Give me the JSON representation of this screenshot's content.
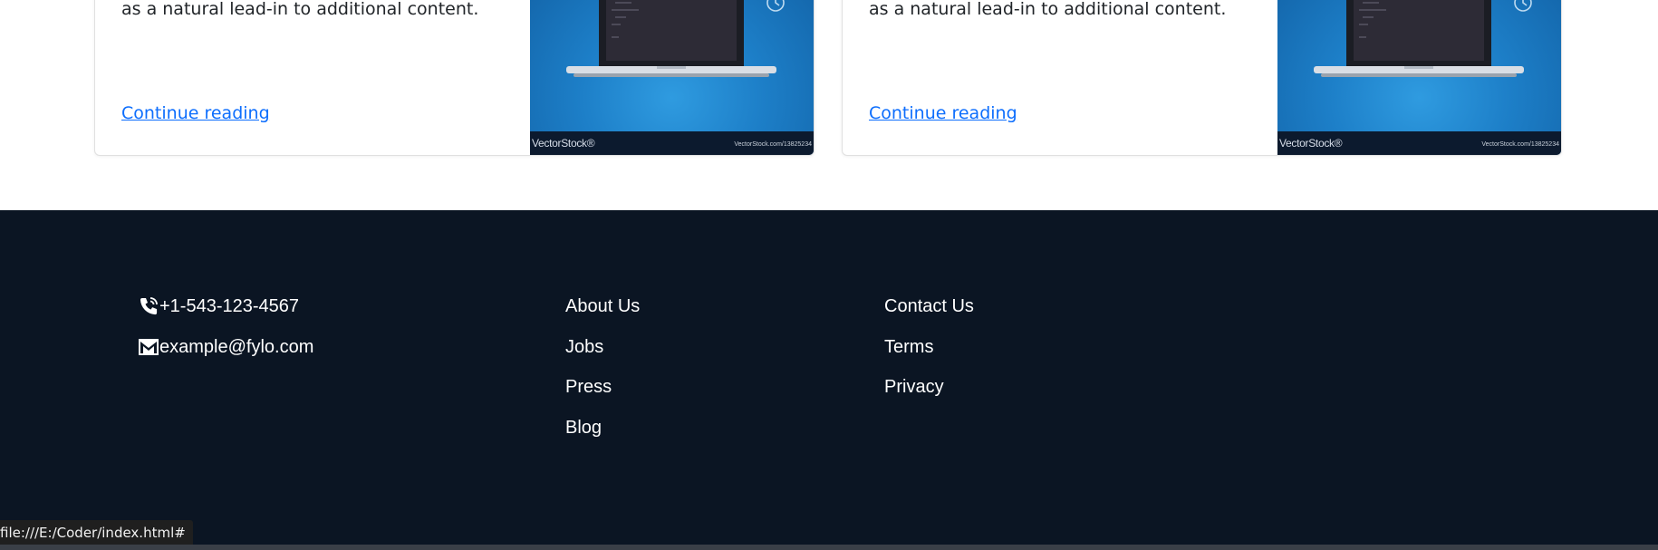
{
  "cards": [
    {
      "text": "as a natural lead-in to additional content.",
      "link": "Continue reading",
      "image_watermark": "VectorStock®",
      "image_id": "VectorStock.com/13825234"
    },
    {
      "text": "as a natural lead-in to additional content.",
      "link": "Continue reading",
      "image_watermark": "VectorStock®",
      "image_id": "VectorStock.com/13825234"
    }
  ],
  "footer": {
    "background": "#0b1523",
    "phone": {
      "icon": "phone-icon",
      "text": "+1-543-123-4567"
    },
    "email": {
      "icon": "mail-icon",
      "text": "example@fylo.com"
    },
    "links_col1": [
      "About Us",
      "Jobs",
      "Press",
      "Blog"
    ],
    "links_col2": [
      "Contact Us",
      "Terms",
      "Privacy"
    ]
  },
  "status_bar": {
    "url": "file:///E:/Coder/index.html#"
  },
  "colors": {
    "link": "#0d6efd",
    "footer_bg": "#0b1523",
    "text": "#212529"
  }
}
